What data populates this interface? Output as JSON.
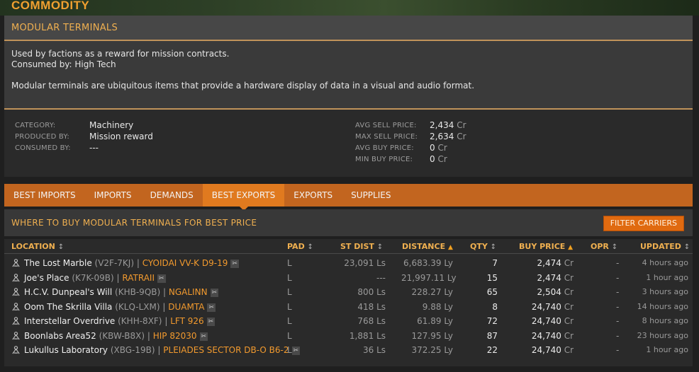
{
  "banner_title": "COMMODITY",
  "commodity_name": "MODULAR TERMINALS",
  "description": {
    "line1": "Used by factions as a reward for mission contracts.",
    "line2": "Consumed by: High Tech",
    "line3": "Modular terminals are ubiquitous items that provide a hardware display of data in a visual and audio format."
  },
  "info": {
    "category_label": "CATEGORY:",
    "category": "Machinery",
    "produced_label": "PRODUCED BY:",
    "produced": "Mission reward",
    "consumed_label": "CONSUMED BY:",
    "consumed": "---",
    "avg_sell_label": "AVG SELL PRICE:",
    "avg_sell": "2,434",
    "max_sell_label": "MAX SELL PRICE:",
    "max_sell": "2,634",
    "avg_buy_label": "AVG BUY PRICE:",
    "avg_buy": "0",
    "min_buy_label": "MIN BUY PRICE:",
    "min_buy": "0",
    "currency": "Cr"
  },
  "tabs": [
    {
      "label": "BEST IMPORTS",
      "active": false
    },
    {
      "label": "IMPORTS",
      "active": false
    },
    {
      "label": "DEMANDS",
      "active": false
    },
    {
      "label": "BEST EXPORTS",
      "active": true
    },
    {
      "label": "EXPORTS",
      "active": false
    },
    {
      "label": "SUPPLIES",
      "active": false
    }
  ],
  "list_title": "WHERE TO BUY MODULAR TERMINALS FOR BEST PRICE",
  "filter_button": "FILTER CARRIERS",
  "columns": {
    "location": "LOCATION",
    "pad": "PAD",
    "st_dist": "ST DIST",
    "distance": "DISTANCE",
    "qty": "QTY",
    "buy_price": "BUY PRICE",
    "opr": "OPR",
    "updated": "UPDATED"
  },
  "sort_glyph": "↕",
  "sort_active_glyph": "▲",
  "unit_ly": "Ly",
  "unit_ls": "Ls",
  "unit_cr": "Cr",
  "rows": [
    {
      "name": "The Lost Marble",
      "code": "(V2F-7KJ)",
      "system": "CYOIDAI VV-K D9-19",
      "pad": "L",
      "st_dist": "23,091",
      "st_unit": "Ls",
      "distance": "6,683.39",
      "qty": "7",
      "price": "2,474",
      "opr": "-",
      "updated": "4 hours ago"
    },
    {
      "name": "Joe's Place",
      "code": "(K7K-09B)",
      "system": "RATRAII",
      "pad": "L",
      "st_dist": "---",
      "st_unit": "",
      "distance": "21,997.11",
      "qty": "15",
      "price": "2,474",
      "opr": "-",
      "updated": "1 hour ago"
    },
    {
      "name": "H.C.V. Dunpeal's Will",
      "code": "(KHB-9QB)",
      "system": "NGALINN",
      "pad": "L",
      "st_dist": "800",
      "st_unit": "Ls",
      "distance": "228.27",
      "qty": "65",
      "price": "2,504",
      "opr": "-",
      "updated": "3 hours ago"
    },
    {
      "name": "Oom The Skrilla Villa",
      "code": "(KLQ-LXM)",
      "system": "DUAMTA",
      "pad": "L",
      "st_dist": "418",
      "st_unit": "Ls",
      "distance": "9.88",
      "qty": "8",
      "price": "24,740",
      "opr": "-",
      "updated": "14 hours ago"
    },
    {
      "name": "Interstellar Overdrive",
      "code": "(KHH-8XF)",
      "system": "LFT 926",
      "pad": "L",
      "st_dist": "768",
      "st_unit": "Ls",
      "distance": "61.89",
      "qty": "72",
      "price": "24,740",
      "opr": "-",
      "updated": "8 hours ago"
    },
    {
      "name": "Boonlabs Area52",
      "code": "(KBW-B8X)",
      "system": "HIP 82030",
      "pad": "L",
      "st_dist": "1,881",
      "st_unit": "Ls",
      "distance": "127.95",
      "qty": "87",
      "price": "24,740",
      "opr": "-",
      "updated": "23 hours ago"
    },
    {
      "name": "Lukullus Laboratory",
      "code": "(XBG-19B)",
      "system": "PLEIADES SECTOR DB-O B6-2",
      "pad": "L",
      "st_dist": "36",
      "st_unit": "Ls",
      "distance": "372.25",
      "qty": "22",
      "price": "24,740",
      "opr": "-",
      "updated": "1 hour ago"
    }
  ]
}
